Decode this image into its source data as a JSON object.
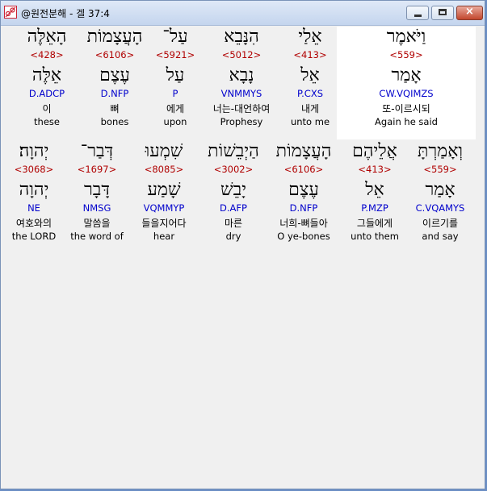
{
  "window": {
    "title": "@원전분해 - 겔 37:4",
    "close_glyph": "×"
  },
  "row1": [
    {
      "heb": "וַיֹּאמֶר",
      "strong": "<559>",
      "lex": "אָמַר",
      "morph": "CW.VQIMZS",
      "kor": "또-이르시되",
      "eng": "Again he said",
      "selected": true
    },
    {
      "heb": "אֵלַי",
      "strong": "<413>",
      "lex": "אֵל",
      "morph": "P.CXS",
      "kor": "내게",
      "eng": "unto me"
    },
    {
      "heb": "הִנָּבֵא",
      "strong": "<5012>",
      "lex": "נָבָא",
      "morph": "VNMMYS",
      "kor": "너는-대언하여",
      "eng": "Prophesy"
    },
    {
      "heb": "עַל־",
      "strong": "<5921>",
      "lex": "עַל",
      "morph": "P",
      "kor": "에게",
      "eng": "upon"
    },
    {
      "heb": "הָעֲצָמוֹת",
      "strong": "<6106>",
      "lex": "עֶצֶם",
      "morph": "D.NFP",
      "kor": "뼈",
      "eng": "bones"
    },
    {
      "heb": "הָאֵלֶּה",
      "strong": "<428>",
      "lex": "אֵלֶּה",
      "morph": "D.ADCP",
      "kor": "이",
      "eng": "these"
    }
  ],
  "row2": [
    {
      "heb": "וְאָמַרְתָּ",
      "strong": "<559>",
      "lex": "אָמַר",
      "morph": "C.VQAMYS",
      "kor": "이르기를",
      "eng": "and say"
    },
    {
      "heb": "אֲלֵיהֶם",
      "strong": "<413>",
      "lex": "אֵל",
      "morph": "P.MZP",
      "kor": "그들에게",
      "eng": "unto them"
    },
    {
      "heb": "הָעֲצָמוֹת",
      "strong": "<6106>",
      "lex": "עֶצֶם",
      "morph": "D.NFP",
      "kor": "너희-뼈들아",
      "eng": "O ye-bones"
    },
    {
      "heb": "הַיְבֵשׁוֹת",
      "strong": "<3002>",
      "lex": "יָבֵשׁ",
      "morph": "D.AFP",
      "kor": "마른",
      "eng": "dry"
    },
    {
      "heb": "שִׁמְעוּ",
      "strong": "<8085>",
      "lex": "שָׁמַע",
      "morph": "VQMMYP",
      "kor": "들을지어다",
      "eng": "hear"
    },
    {
      "heb": "דְּבַר־",
      "strong": "<1697>",
      "lex": "דָּבָר",
      "morph": "NMSG",
      "kor": "말씀을",
      "eng": "the word of"
    },
    {
      "heb": "יְהוָה׃",
      "strong": "<3068>",
      "lex": "יְהוָה",
      "morph": "NE",
      "kor": "여호와의",
      "eng": "the LORD"
    }
  ]
}
